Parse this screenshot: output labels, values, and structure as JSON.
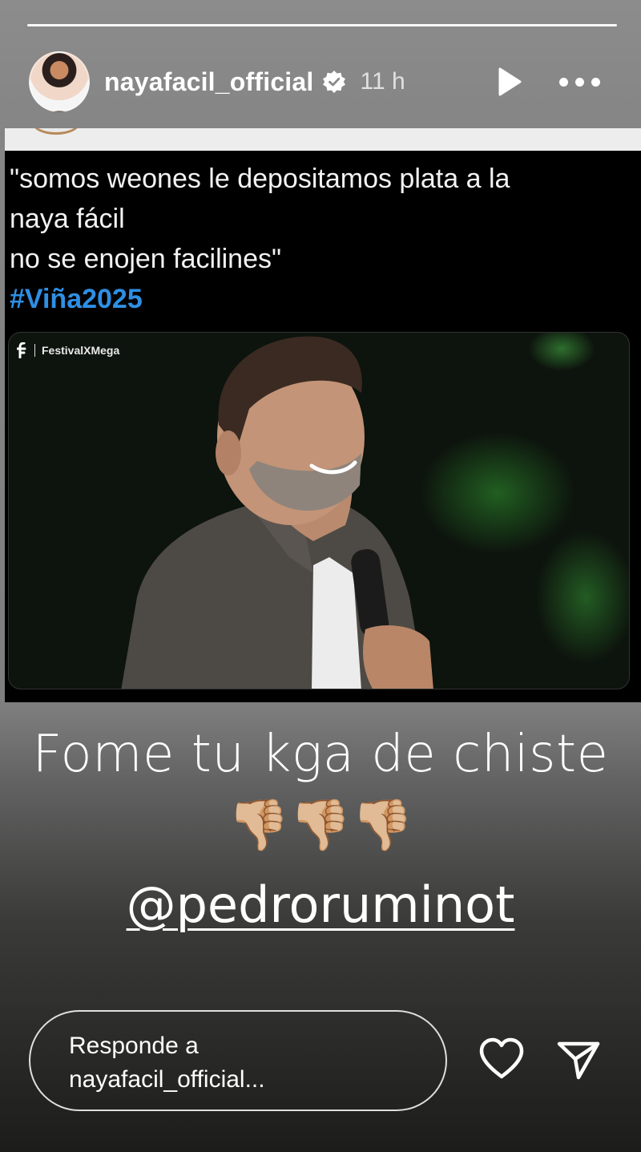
{
  "story": {
    "segments_total": 1,
    "segments_done": 1
  },
  "header": {
    "username": "nayafacil_official",
    "time": "11 h",
    "verified_icon": "verified-badge-icon",
    "play_icon": "play-icon",
    "more_icon": "more-dots-icon"
  },
  "post": {
    "text_lines": [
      "\"somos weones le depositamos plata a la",
      "naya fácil",
      "no se enojen facilines\""
    ],
    "hashtag": "#Viña2025",
    "hashtag_color": "#2f8fe3",
    "watermark": "FestivalXMega"
  },
  "overlay": {
    "caption": "Fome tu kga de chiste",
    "emojis": "👎🏼👎🏼👎🏼",
    "mention": "@pedroruminot"
  },
  "reply": {
    "line1": "Responde a",
    "line2": "nayafacil_official...",
    "heart_icon": "heart-icon",
    "send_icon": "send-icon"
  }
}
